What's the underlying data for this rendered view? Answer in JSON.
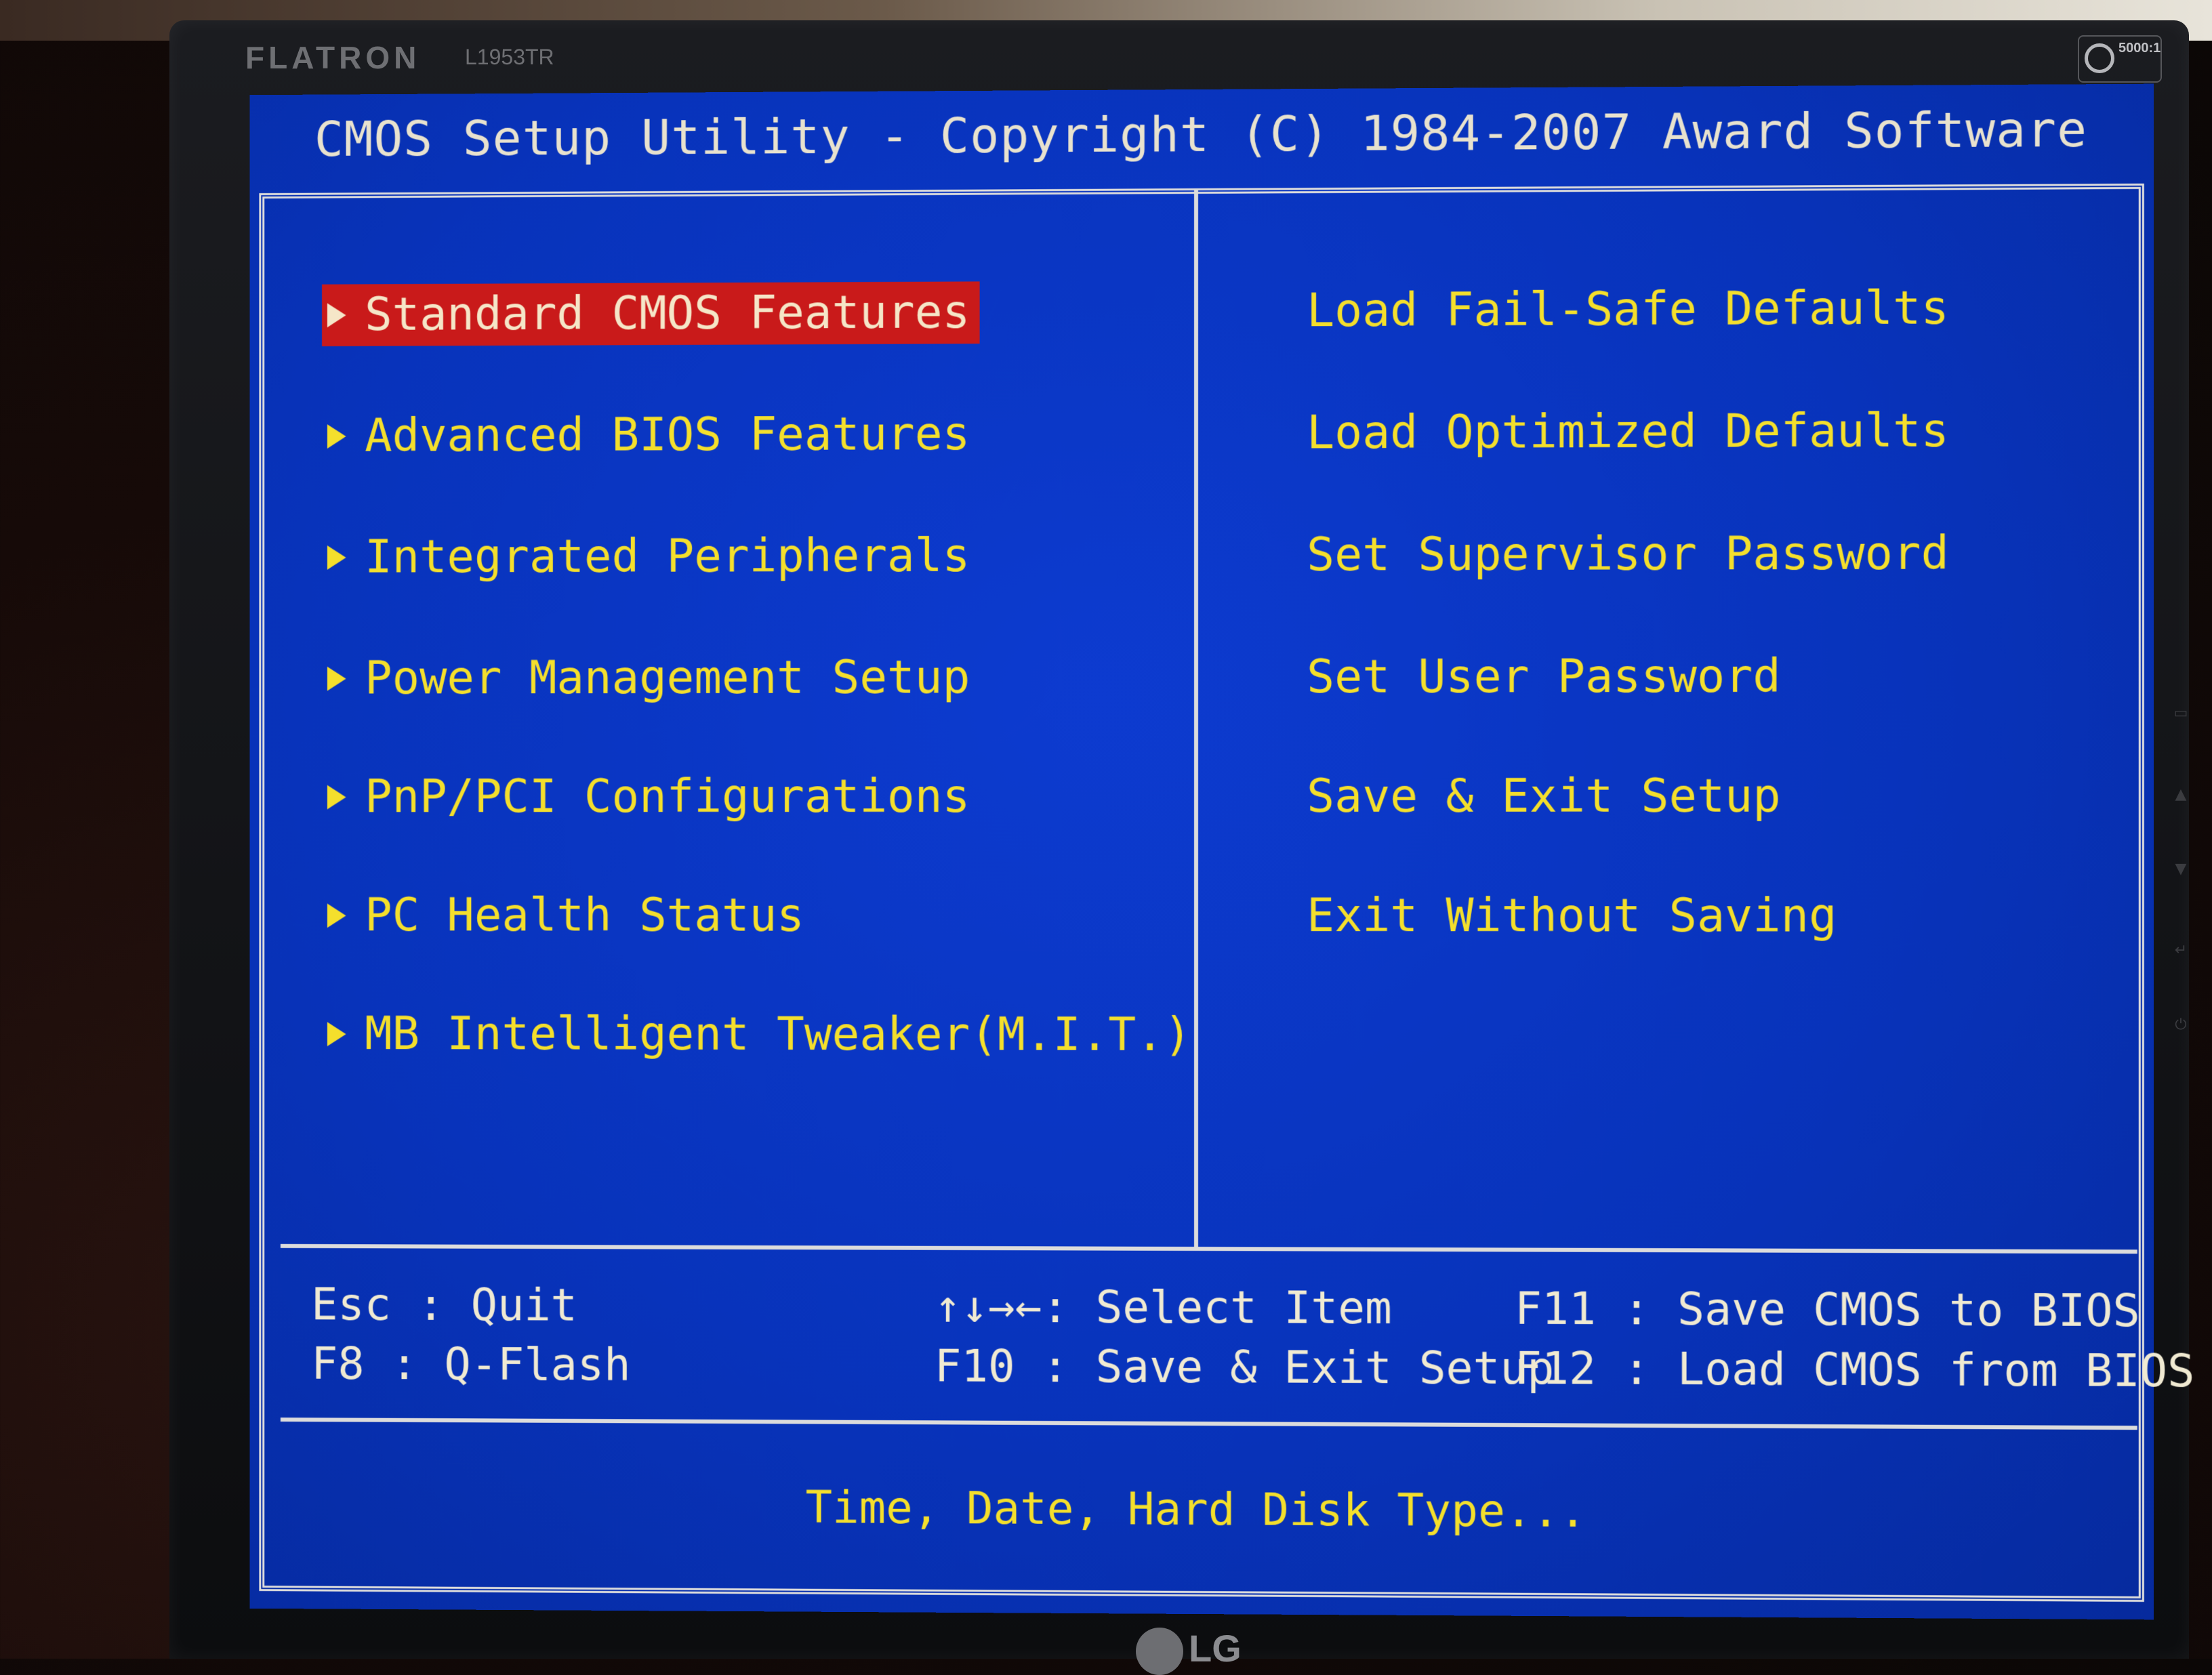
{
  "monitor": {
    "brand": "FLATRON",
    "model": "L1953TR",
    "badge_ratio": "5000:1",
    "logo": "LG"
  },
  "bios": {
    "title": "CMOS Setup Utility - Copyright (C) 1984-2007 Award Software",
    "left_menu": [
      {
        "label": "Standard CMOS Features",
        "selected": true
      },
      {
        "label": "Advanced BIOS Features",
        "selected": false
      },
      {
        "label": "Integrated Peripherals",
        "selected": false
      },
      {
        "label": "Power Management Setup",
        "selected": false
      },
      {
        "label": "PnP/PCI Configurations",
        "selected": false
      },
      {
        "label": "PC Health Status",
        "selected": false
      },
      {
        "label": "MB Intelligent Tweaker(M.I.T.)",
        "selected": false
      }
    ],
    "right_menu": [
      "Load Fail-Safe Defaults",
      "Load Optimized Defaults",
      "Set Supervisor Password",
      "Set User Password",
      "Save & Exit Setup",
      "Exit Without Saving"
    ],
    "keys": {
      "esc": "Esc  : Quit",
      "f8": "F8   : Q-Flash",
      "arrows": "↑↓→←: Select Item",
      "f10": "F10 : Save & Exit Setup",
      "f11": "F11  : Save CMOS to BIOS",
      "f12": "F12  : Load CMOS from BIOS"
    },
    "help_text": "Time, Date, Hard Disk Type...",
    "colors": {
      "background": "#0833bb",
      "menu_text": "#f4df2c",
      "highlight": "#c91a1a",
      "title_text": "#e8e2ce"
    }
  }
}
